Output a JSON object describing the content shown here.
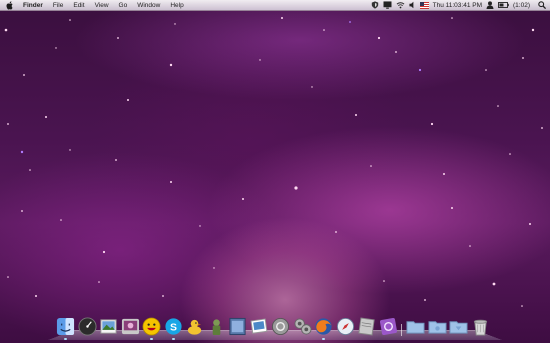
{
  "menubar": {
    "apple_icon": "apple-logo-icon",
    "app_name": "Finder",
    "menus": [
      "File",
      "Edit",
      "View",
      "Go",
      "Window",
      "Help"
    ],
    "status": {
      "clock": "Thu 11:03:41 PM",
      "battery": "(1:02)",
      "icons": [
        "shield-icon",
        "display-icon",
        "wifi-icon",
        "volume-icon",
        "flag-icon",
        "user-icon",
        "battery-icon",
        "spotlight-icon"
      ]
    }
  },
  "dock": {
    "apps": [
      {
        "name": "finder",
        "running": true
      },
      {
        "name": "dashboard",
        "running": false
      },
      {
        "name": "iphoto",
        "running": false
      },
      {
        "name": "photo-booth",
        "running": false
      },
      {
        "name": "yahoo-messenger",
        "running": true
      },
      {
        "name": "skype",
        "running": true
      },
      {
        "name": "adium",
        "running": false
      },
      {
        "name": "keychain",
        "running": false
      },
      {
        "name": "preview",
        "running": false
      },
      {
        "name": "ichat",
        "running": false
      },
      {
        "name": "utility",
        "running": false
      },
      {
        "name": "system-preferences",
        "running": false
      },
      {
        "name": "firefox",
        "running": true
      },
      {
        "name": "safari",
        "running": false
      },
      {
        "name": "textedit",
        "running": false
      },
      {
        "name": "quicksilver",
        "running": false
      }
    ],
    "folders": [
      "applications-folder",
      "documents-folder",
      "downloads-folder",
      "trash"
    ]
  },
  "colors": {
    "wallpaper_base": "#4a1450",
    "wallpaper_glow": "#ff9fd6",
    "menubar": "#e8e4ea"
  }
}
